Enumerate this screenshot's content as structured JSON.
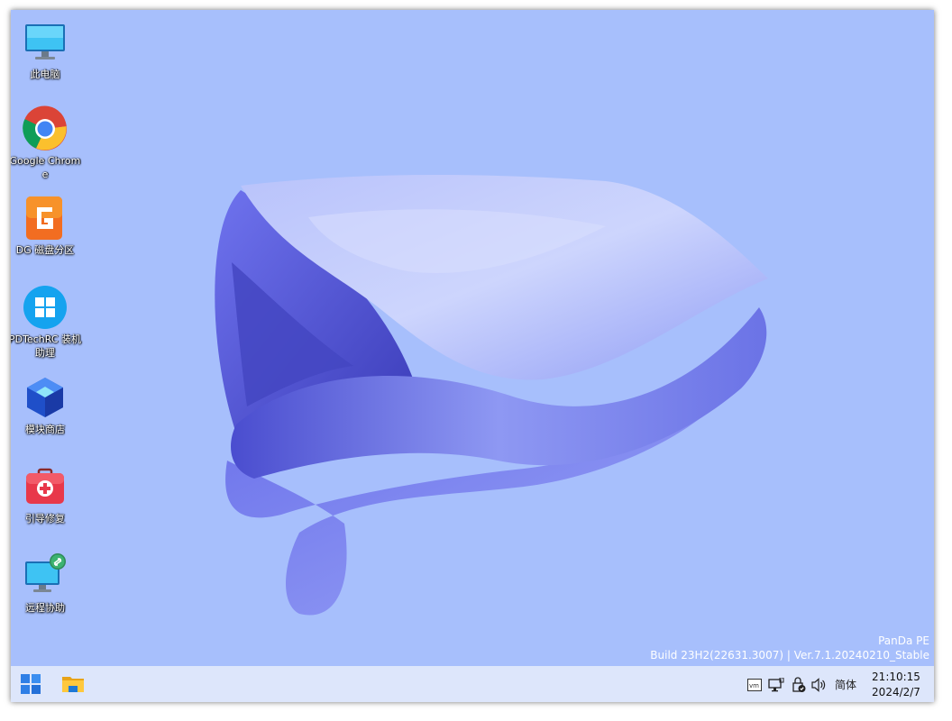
{
  "desktop": {
    "icons": [
      {
        "label": "此电脑",
        "icon": "monitor-icon"
      },
      {
        "label": "Google Chrome",
        "icon": "chrome-icon"
      },
      {
        "label": "DG 磁盘分区",
        "icon": "diskgenius-icon"
      },
      {
        "label": "PDTechRC 装机助理",
        "icon": "windows-icon"
      },
      {
        "label": "模块商店",
        "icon": "cube-icon"
      },
      {
        "label": "引导修复",
        "icon": "toolbox-icon"
      },
      {
        "label": "远程协助",
        "icon": "remote-desktop-icon"
      }
    ]
  },
  "watermark": {
    "line1": "PanDa PE",
    "line2": "Build 23H2(22631.3007) | Ver.7.1.20240210_Stable"
  },
  "taskbar": {
    "start_icon": "windows-start-icon",
    "pinned": [
      {
        "icon": "file-explorer-icon"
      }
    ],
    "tray": {
      "icons": [
        "vmware-icon",
        "network-icon",
        "security-icon",
        "volume-icon"
      ],
      "language": "简体",
      "time": "21:10:15",
      "date": "2024/2/7"
    }
  },
  "colors": {
    "desktop_background": "#a7bffc",
    "taskbar_background": "#dde6fb",
    "wallpaper_accent": "#5a5ee0"
  }
}
